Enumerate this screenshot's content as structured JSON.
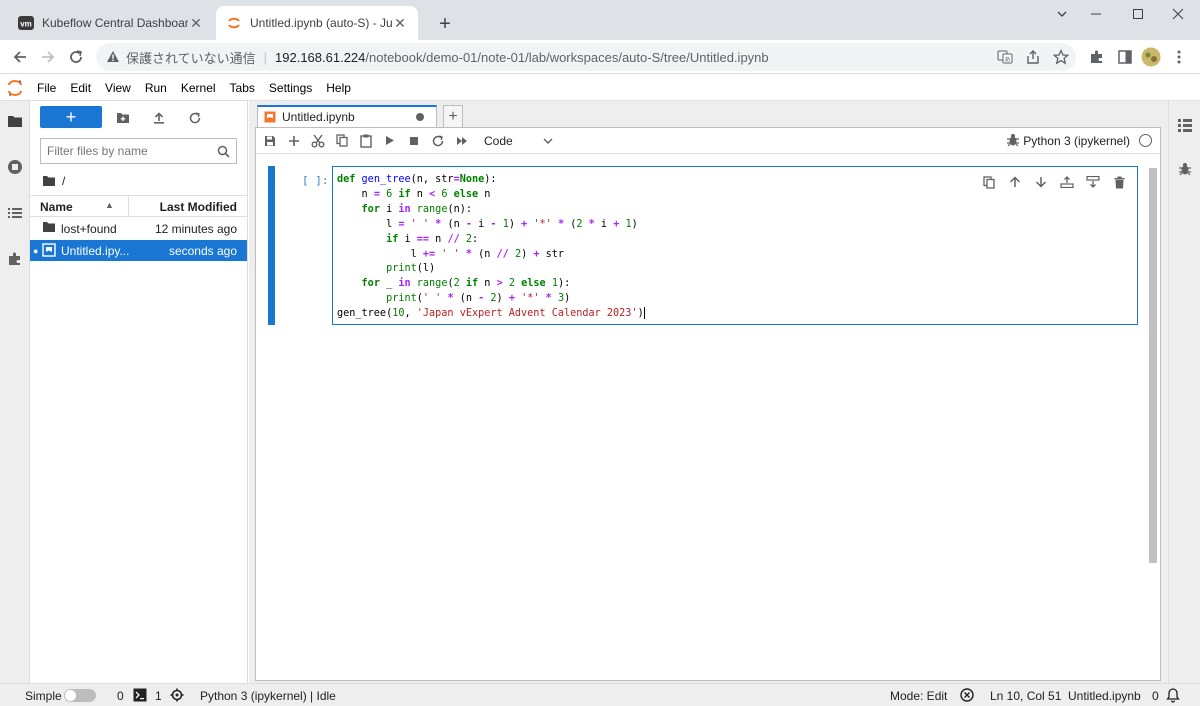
{
  "browser": {
    "tabs": [
      {
        "title": "Kubeflow Central Dashboard",
        "favicon": "vm"
      },
      {
        "title": "Untitled.ipynb (auto-S) - Jupyter"
      }
    ],
    "security_text": "保護されていない通信",
    "url_host": "192.168.61.224",
    "url_path": "/notebook/demo-01/note-01/lab/workspaces/auto-S/tree/Untitled.ipynb"
  },
  "menubar": {
    "items": [
      "File",
      "Edit",
      "View",
      "Run",
      "Kernel",
      "Tabs",
      "Settings",
      "Help"
    ]
  },
  "filebrowser": {
    "new_label": "+",
    "filter_placeholder": "Filter files by name",
    "crumb": "/",
    "col_name": "Name",
    "col_modified": "Last Modified",
    "files": [
      {
        "name": "lost+found",
        "modified": "12 minutes ago",
        "type": "folder"
      },
      {
        "name": "Untitled.ipy...",
        "modified": "seconds ago",
        "type": "notebook"
      }
    ]
  },
  "notebook": {
    "tab_title": "Untitled.ipynb",
    "cell_type": "Code",
    "kernel": "Python 3 (ipykernel)",
    "prompt": "[ ]:"
  },
  "statusbar": {
    "simple": "Simple",
    "terminals": "0",
    "kernels_count": "1",
    "kernel_status": "Python 3 (ipykernel) | Idle",
    "mode": "Mode: Edit",
    "position": "Ln 10, Col 51",
    "filename": "Untitled.ipynb",
    "notifications": "0"
  },
  "colors": {
    "accent": "#1976d2",
    "jupyter_orange": "#f37726"
  },
  "icons": [
    "search-icon",
    "folder-icon",
    "upload-icon",
    "refresh-icon",
    "save-icon",
    "cut-icon",
    "copy-icon",
    "paste-icon",
    "run-icon",
    "stop-icon",
    "restart-icon",
    "fast-forward-icon",
    "bug-icon",
    "puzzle-icon",
    "extensions-icon",
    "running-icon",
    "toc-icon",
    "property-inspector-icon"
  ]
}
